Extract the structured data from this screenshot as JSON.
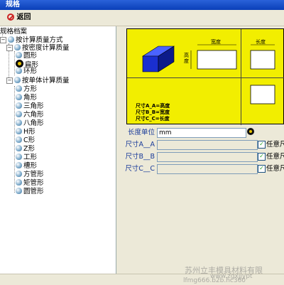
{
  "window": {
    "title": "规格"
  },
  "toolbar": {
    "ok_label": "",
    "back_label": "返回"
  },
  "tree": {
    "root": "规格档案",
    "items": [
      {
        "label": "按计算质量方式",
        "level": 1
      },
      {
        "label": "按密度计算质量",
        "level": 2
      },
      {
        "label": "圆形",
        "level": 3
      },
      {
        "label": "扁形",
        "level": 3
      },
      {
        "label": "环形",
        "level": 3
      },
      {
        "label": "按单体计算质量",
        "level": 2
      },
      {
        "label": "方形",
        "level": 3
      },
      {
        "label": "角形",
        "level": 3
      },
      {
        "label": "三角形",
        "level": 3
      },
      {
        "label": "六角形",
        "level": 3
      },
      {
        "label": "八角形",
        "level": 3
      },
      {
        "label": "H形",
        "level": 3
      },
      {
        "label": "C形",
        "level": 3
      },
      {
        "label": "Z形",
        "level": 3
      },
      {
        "label": "工形",
        "level": 3
      },
      {
        "label": "槽形",
        "level": 3
      },
      {
        "label": "方管形",
        "level": 3
      },
      {
        "label": "矩管形",
        "level": 3
      },
      {
        "label": "圆管形",
        "level": 3
      }
    ]
  },
  "preview": {
    "label_width": "宽度",
    "label_height": "高度",
    "label_length": "长度",
    "legend_a": "尺寸A_A=高度",
    "legend_b": "尺寸B_B=宽度",
    "legend_c": "尺寸C_C=长度",
    "colors": {
      "background": "#f2ee00",
      "box": "#1a2fd0"
    }
  },
  "form": {
    "unit_label": "长度单位",
    "unit_value": "mm",
    "size_a_label": "尺寸A__A",
    "size_b_label": "尺寸B__B",
    "size_c_label": "尺寸C__C",
    "size_a_value": "",
    "size_b_value": "",
    "size_c_value": "",
    "any_label_a": "任意尺",
    "any_label_b": "任意尺",
    "any_label_c": "任意尺"
  },
  "watermark": {
    "line1": "苏州立丰模具材料有限",
    "line2": "www.zgxjjypt",
    "line3": "lfmg666.b2b.hc360"
  }
}
